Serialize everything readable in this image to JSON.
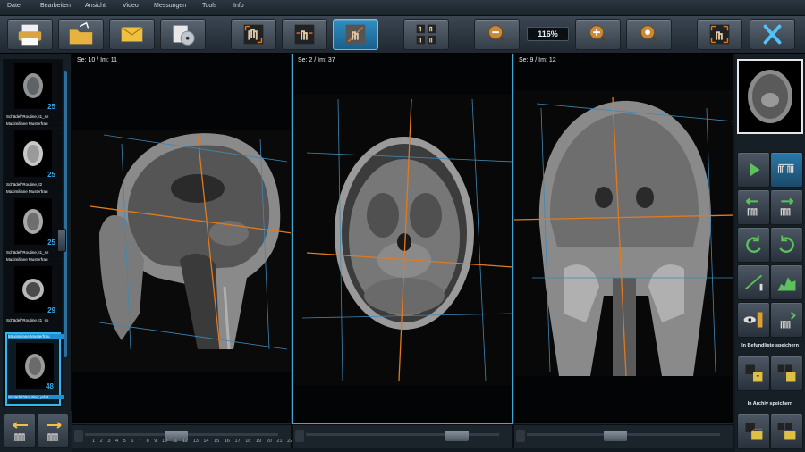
{
  "menu": [
    "Datei",
    "Bearbeiten",
    "Ansicht",
    "Video",
    "Messungen",
    "Tools",
    "Info"
  ],
  "toolbar": {
    "zoom_level": "116%",
    "buttons": [
      "print",
      "open-folder",
      "email",
      "save-cd",
      "layout-1",
      "layout-2",
      "layout-3",
      "layout-4",
      "zoom-out",
      "zoom-in",
      "zoom-fit",
      "fullscreen",
      "close"
    ]
  },
  "thumbnails": [
    {
      "number": "25",
      "label": "Schädel^Routine, t1_se",
      "patient": "Maximiliane Musterfrau",
      "selected": false
    },
    {
      "number": "25",
      "label": "Schädel^Routine, t2",
      "patient": "Maximiliane Musterfrau",
      "selected": false
    },
    {
      "number": "25",
      "label": "Schädel^Routine, t1_se",
      "patient": "Maximiliane Musterfrau",
      "selected": false
    },
    {
      "number": "29",
      "label": "Schädel^Routine, t1_se",
      "patient": "Maximiliane Musterfrau",
      "selected": false
    },
    {
      "number": "48",
      "label": "Schädel^Routine, pd+t",
      "patient": "Maximiliane Musterfrau",
      "selected": true
    }
  ],
  "viewports": [
    {
      "label": "Se: 10 / Im: 11",
      "active": false,
      "view": "sagittal"
    },
    {
      "label": "Se: 2 / Im: 37",
      "active": true,
      "view": "axial"
    },
    {
      "label": "Se: 9 / Im: 12",
      "active": false,
      "view": "coronal"
    }
  ],
  "scroll_ticks": [
    "1",
    "2",
    "3",
    "4",
    "5",
    "6",
    "7",
    "8",
    "9",
    "10",
    "11",
    "12",
    "13",
    "14",
    "15",
    "16",
    "17",
    "18",
    "19",
    "20",
    "21",
    "22"
  ],
  "right_panel": {
    "befund_label": "In Befundliste speichern",
    "archiv_label": "In Archiv speichern"
  },
  "colors": {
    "accent": "#2fb8f0",
    "crosshair": "#e07a1f",
    "scanline": "#3f87b5"
  }
}
